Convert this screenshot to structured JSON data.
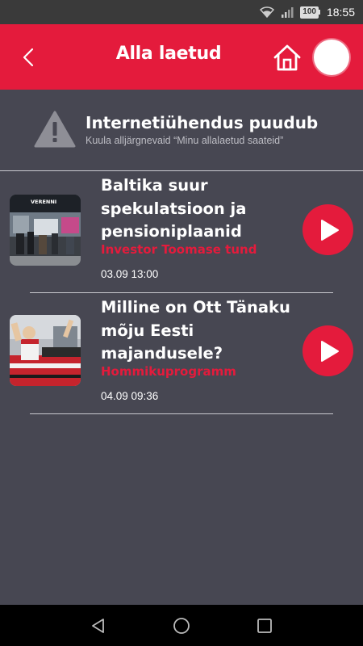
{
  "status_bar": {
    "time": "18:55",
    "battery": "100",
    "icons": [
      "wifi-icon",
      "signal-icon",
      "battery-icon"
    ]
  },
  "app_bar": {
    "title": "Alla laetud",
    "icons": [
      "back-arrow-icon",
      "home-icon",
      "profile-avatar"
    ]
  },
  "offline_notice": {
    "title": "Internetiühendus puudub",
    "subtitle": "Kuula alljärgnevaid “Minu allalaetud saateid”",
    "icon": "warning-icon"
  },
  "episodes": [
    {
      "title_lines": [
        "Baltika suur",
        "spekulatsioon ja",
        "pensioniplaanid"
      ],
      "show": "Investor Toomase tund",
      "date": "03.09 13:00",
      "thumbnail_text": "VERENNI"
    },
    {
      "title_lines": [
        "Milline on Ott Tänaku",
        "mõju Eesti",
        "majandusele?"
      ],
      "show": "Hommikuprogramm",
      "date": "04.09 09:36"
    }
  ],
  "colors": {
    "accent": "#e41b3c",
    "background": "#474752",
    "status_bar": "#3a3a3a",
    "nav_bar": "#000000"
  },
  "nav_bar": {
    "icons": [
      "back-triangle-icon",
      "home-circle-icon",
      "recents-square-icon"
    ]
  }
}
